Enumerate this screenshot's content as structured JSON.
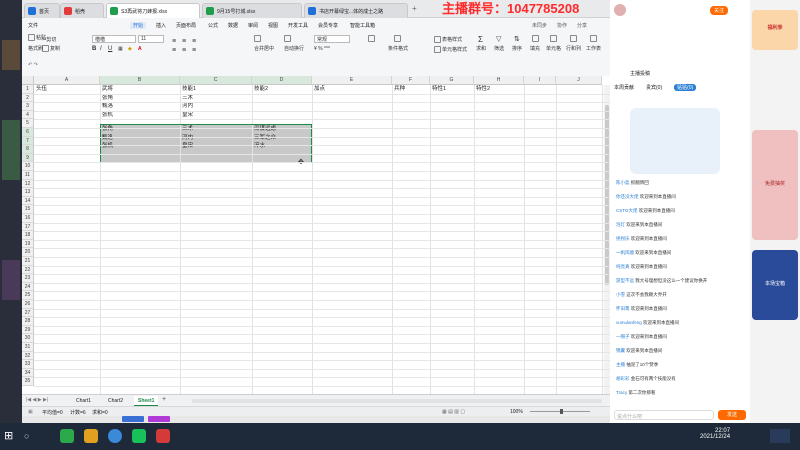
{
  "overlay": {
    "text": "主播群号：1047785208",
    "color": "#ff2a2a"
  },
  "tabs": [
    {
      "label": "首页",
      "color": "#1e6fd6"
    },
    {
      "label": "稻壳",
      "color": "#e23b3b"
    },
    {
      "label": "S3再武将刀蜂报.xlsx",
      "color": "#1e9e4a",
      "active": true
    },
    {
      "label": "9月15号打城.xlsx",
      "color": "#1e9e4a"
    },
    {
      "label": "书店开幕绿宝...体的成士之路",
      "color": "#1e6fd6"
    }
  ],
  "menu": [
    "文件",
    "开始",
    "插入",
    "页面布局",
    "公式",
    "数据",
    "审阅",
    "视图",
    "开发工具",
    "会员专享",
    "智能工具箱"
  ],
  "right_menu": [
    "未同步",
    "协作",
    "分享"
  ],
  "toolbar": {
    "paste": "粘贴",
    "cut": "剪切",
    "copy": "复制",
    "format_painter": "格式刷",
    "font": "楷楷",
    "font_size": "11",
    "merge": "合并居中",
    "wrap": "自动换行",
    "number_format": "常规",
    "cond_format": "条件格式",
    "table_style": "表格样式",
    "cell_style": "单元格样式",
    "sum": "求和",
    "filter": "筛选",
    "sort": "排序",
    "fill": "填充",
    "cell": "单元格",
    "row_col": "行和列",
    "worksheet": "工作表",
    "freeze": "冻结窗格",
    "table_tools": "表格工具",
    "find": "查找",
    "symbol": "符号"
  },
  "formula_bar": {
    "name_box": "B6",
    "fx": "fx",
    "value": "张角"
  },
  "columns": [
    "A",
    "B",
    "C",
    "D",
    "E",
    "F",
    "G",
    "H",
    "I",
    "J"
  ],
  "rows": [
    "1",
    "2",
    "3",
    "4",
    "5",
    "6",
    "7",
    "8",
    "9",
    "10",
    "11",
    "12",
    "13",
    "14",
    "15",
    "16",
    "17",
    "18",
    "19",
    "20",
    "21",
    "22",
    "23",
    "24",
    "25",
    "26",
    "27",
    "28",
    "29",
    "30",
    "31",
    "32",
    "33",
    "34",
    "35"
  ],
  "cells": {
    "header": [
      "头伍",
      "武将",
      "技能1",
      "技能2",
      "加点",
      "兵种",
      "特性1",
      "特性2"
    ],
    "r2": [
      "张角",
      "三术"
    ],
    "r3": [
      "甄洛",
      "河内"
    ],
    "r4": [
      "张机",
      "皇宋"
    ],
    "r6": [
      "张角",
      "三术",
      "深谋远虑"
    ],
    "r7": [
      "甄洛",
      "河内",
      "三军之众"
    ],
    "r8": [
      "张机",
      "皇宋",
      "淬水"
    ]
  },
  "sheets": [
    "Chart1",
    "Chart2",
    "Sheet1"
  ],
  "active_sheet": "Sheet1",
  "status": {
    "avg": "平均值=0",
    "count": "计数=6",
    "sum": "求和=0",
    "zoom": "100%"
  },
  "chat": {
    "header": "主播投稿",
    "tabs": [
      "本周贡献",
      "贵宾(0)",
      "贴贴(0)"
    ],
    "follow": "关注",
    "lines": [
      {
        "name": "陈小盈",
        "msg": "抓翻牌回"
      },
      {
        "name": "你还没大佬",
        "msg": "欢迎来到本直播间"
      },
      {
        "name": "CSTG大佬",
        "msg": "欢迎来到本直播间"
      },
      {
        "name": "泡灯",
        "msg": "欢迎来到本直播间"
      },
      {
        "name": "拐拐乐",
        "msg": "欢迎来到本直播间"
      },
      {
        "name": "一帆风顺",
        "msg": "欢迎来到本直播间"
      },
      {
        "name": "纯亮真",
        "msg": "欢迎来到本直播间"
      },
      {
        "name": "游型不远",
        "msg": "我大号理想但没这么一个建议你换开"
      },
      {
        "name": "小雪",
        "msg": "这次不会我赖大乔开"
      },
      {
        "name": "怀旧篝",
        "msg": "欢迎来到本直播间"
      },
      {
        "name": "vumulanfeng",
        "msg": "欢迎来到本直播间"
      },
      {
        "name": "一帽子",
        "msg": "欢迎来到本直播间"
      },
      {
        "name": "锦囊",
        "msg": "欢迎来到本直播间"
      },
      {
        "name": "主播",
        "msg": "抽泥了10个赞季"
      },
      {
        "name": "胡彩彩",
        "msg": "金石可有两个技能没有"
      },
      {
        "name": "Tracy",
        "msg": "第二次你那看"
      }
    ],
    "input_placeholder": "说点什么吧",
    "send": "发送"
  },
  "ads": [
    "福利季",
    "免费抽奖",
    "本场宝箱"
  ],
  "clock": {
    "time": "22:07",
    "date": "2021/12/24"
  }
}
